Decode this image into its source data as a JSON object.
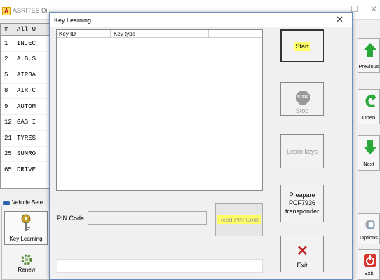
{
  "background": {
    "app_title": "ABRITES Di",
    "logo_letter": "A",
    "table": {
      "header": [
        "#",
        "All U"
      ],
      "rows": [
        [
          "1",
          "INJEC"
        ],
        [
          "2",
          "A.B.S"
        ],
        [
          "5",
          "AIRBA"
        ],
        [
          "8",
          "AIR C"
        ],
        [
          "9",
          "AUTOM"
        ],
        [
          "12",
          "GAS I"
        ],
        [
          "21",
          "TYRES"
        ],
        [
          "25",
          "SUNRO"
        ],
        [
          "65",
          "DRIVE"
        ]
      ]
    },
    "vehicle_label": "Vehicle Sele",
    "key_learning_label": "Key Learning",
    "renew_label": "Renew",
    "right_buttons": {
      "previous": "Previous",
      "open": "Open",
      "next": "Next",
      "options": "Options",
      "exit": "Exit"
    }
  },
  "dialog": {
    "title": "Key Learning",
    "close_glyph": "✕",
    "table_headers": [
      "Key ID",
      "Key type"
    ],
    "pin_label": "PIN Code",
    "pin_value": "",
    "read_pin_label": "Read PIN Code",
    "buttons": {
      "start": "Start",
      "stop": "Stop",
      "stop_sign": "STOP",
      "learn": "Learn keys",
      "prepare": "Preapare PCF7936 transponder",
      "exit": "Exit"
    },
    "highlight_color": "#ffff66",
    "exit_icon_color": "#c0272d"
  }
}
